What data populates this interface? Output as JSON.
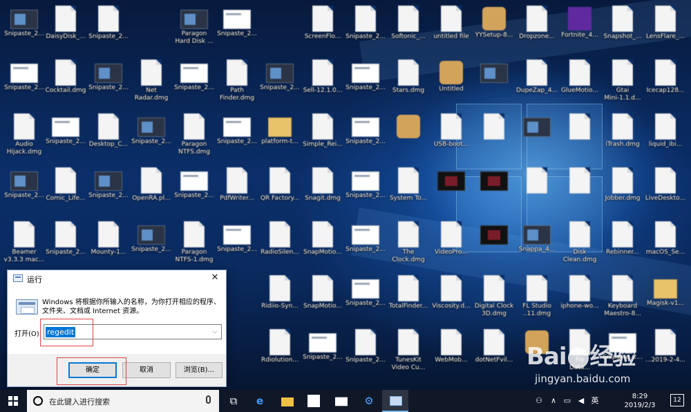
{
  "desktop": {
    "icons": [
      {
        "label": "Snipaste_2...",
        "kind": "dark"
      },
      {
        "label": "DaisyDisk_...",
        "kind": "file"
      },
      {
        "label": "Snipaste_2...",
        "kind": "file"
      },
      {
        "label": "Paragon\nHard Disk ...",
        "kind": "dark"
      },
      {
        "label": "Snipaste_2...",
        "kind": "shot"
      },
      {
        "label": "ScreenFlo...",
        "kind": "file"
      },
      {
        "label": "Snipaste_2...",
        "kind": "file"
      },
      {
        "label": "Softonic_...",
        "kind": "file"
      },
      {
        "label": "untitled file",
        "kind": "file"
      },
      {
        "label": "YYSetup-8...",
        "kind": "app"
      },
      {
        "label": "Dropzone...",
        "kind": "file"
      },
      {
        "label": "Fortnite_4...",
        "kind": "purple"
      },
      {
        "label": "Snapshot_...",
        "kind": "file"
      },
      {
        "label": "LensFlare_...",
        "kind": "file"
      },
      {
        "label": "Snipaste_2...",
        "kind": "shot"
      },
      {
        "label": "Cocktail.dmg",
        "kind": "file"
      },
      {
        "label": "Snipaste_2...",
        "kind": "dark"
      },
      {
        "label": "Net\nRadar.dmg",
        "kind": "file"
      },
      {
        "label": "Snipaste_2...",
        "kind": "shot"
      },
      {
        "label": "Path\nFinder.dmg",
        "kind": "file"
      },
      {
        "label": "Snipaste_2...",
        "kind": "dark"
      },
      {
        "label": "Sell-12.1.0...",
        "kind": "file"
      },
      {
        "label": "Snipaste_2...",
        "kind": "shot"
      },
      {
        "label": "Stars.dmg",
        "kind": "file"
      },
      {
        "label": "Untitled",
        "kind": "app"
      },
      {
        "label": "",
        "kind": "dark"
      },
      {
        "label": "DupeZap_4...",
        "kind": "file"
      },
      {
        "label": "GlueMotio...",
        "kind": "file"
      },
      {
        "label": "Gtai\nMini-1.1.d...",
        "kind": "file"
      },
      {
        "label": "Icecap128...",
        "kind": "file"
      },
      {
        "label": "Audio\nHijack.dmg",
        "kind": "file"
      },
      {
        "label": "Snipaste_2...",
        "kind": "shot"
      },
      {
        "label": "Desktop_C...",
        "kind": "file"
      },
      {
        "label": "Snipaste_2...",
        "kind": "dark"
      },
      {
        "label": "Paragon\nNTFS.dmg",
        "kind": "file"
      },
      {
        "label": "Snipaste_2...",
        "kind": "shot"
      },
      {
        "label": "platform-t...",
        "kind": "folder"
      },
      {
        "label": "Simple_Rei...",
        "kind": "file"
      },
      {
        "label": "Snipaste_2...",
        "kind": "shot"
      },
      {
        "label": "",
        "kind": "app"
      },
      {
        "label": "USB-boot...",
        "kind": "file"
      },
      {
        "label": "",
        "kind": "file"
      },
      {
        "label": "",
        "kind": "dark"
      },
      {
        "label": "",
        "kind": "file"
      },
      {
        "label": "iTrash.dmg",
        "kind": "file"
      },
      {
        "label": "liquid_ibi...",
        "kind": "file"
      },
      {
        "label": "Snipaste_2...",
        "kind": "dark"
      },
      {
        "label": "Comic_Life...",
        "kind": "file"
      },
      {
        "label": "Snipaste_2...",
        "kind": "dark"
      },
      {
        "label": "OpenRA.pl...",
        "kind": "file"
      },
      {
        "label": "Snipaste_2...",
        "kind": "shot"
      },
      {
        "label": "PdfWriter...",
        "kind": "file"
      },
      {
        "label": "QR Factory...",
        "kind": "file"
      },
      {
        "label": "Snagit.dmg",
        "kind": "file"
      },
      {
        "label": "Snipaste_2...",
        "kind": "shot"
      },
      {
        "label": "System To...",
        "kind": "file"
      },
      {
        "label": "",
        "kind": "black"
      },
      {
        "label": "",
        "kind": "black"
      },
      {
        "label": "",
        "kind": "file"
      },
      {
        "label": "",
        "kind": "file"
      },
      {
        "label": "Jobber.dmg",
        "kind": "file"
      },
      {
        "label": "LiveDeskto...",
        "kind": "file"
      },
      {
        "label": "Beamer\nv3.3.3 mac...",
        "kind": "file"
      },
      {
        "label": "Snipaste_2...",
        "kind": "file"
      },
      {
        "label": "Mounty-1...",
        "kind": "file"
      },
      {
        "label": "Snipaste_2...",
        "kind": "dark"
      },
      {
        "label": "Paragon\nNTFS-1.dmg",
        "kind": "file"
      },
      {
        "label": "Snipaste_2...",
        "kind": "shot"
      },
      {
        "label": "RadioSilen...",
        "kind": "file"
      },
      {
        "label": "SnapMotio...",
        "kind": "file"
      },
      {
        "label": "Snipaste_2...",
        "kind": "shot"
      },
      {
        "label": "The\nClock.dmg",
        "kind": "file"
      },
      {
        "label": "VideoPro...",
        "kind": "file"
      },
      {
        "label": "",
        "kind": "black"
      },
      {
        "label": "Snappa_4...",
        "kind": "dark"
      },
      {
        "label": "Disk\nClean.dmg",
        "kind": "file"
      },
      {
        "label": "Rebinner...",
        "kind": "file"
      },
      {
        "label": "macOS_Se...",
        "kind": "file"
      },
      {
        "label": "Ridiio-Syn...",
        "kind": "file"
      },
      {
        "label": "SnapMotio...",
        "kind": "file"
      },
      {
        "label": "Snipaste_2...",
        "kind": "shot"
      },
      {
        "label": "TotalFinder...",
        "kind": "file"
      },
      {
        "label": "Viscosity.d...",
        "kind": "file"
      },
      {
        "label": "Digital Clock\n3D.dmg",
        "kind": "file"
      },
      {
        "label": "FL Studio\n..11.dmg",
        "kind": "file"
      },
      {
        "label": "iphone-wo...",
        "kind": "file"
      },
      {
        "label": "Keyboard\nMaestro-8...",
        "kind": "file"
      },
      {
        "label": "Magisk-v1...",
        "kind": "folder"
      },
      {
        "label": "Rdiolution...",
        "kind": "file"
      },
      {
        "label": "Snipaste_2...",
        "kind": "shot"
      },
      {
        "label": "Snipaste_2...",
        "kind": "file"
      },
      {
        "label": "TunesKit\nVideo Cu...",
        "kind": "file"
      },
      {
        "label": "WebMob...",
        "kind": "file"
      },
      {
        "label": "dotNetFvil...",
        "kind": "file"
      },
      {
        "label": "",
        "kind": "app"
      },
      {
        "label": "Fix\nData...",
        "kind": "file"
      },
      {
        "label": "Snipaste_2...",
        "kind": "shot"
      },
      {
        "label": "...2019-2-4...",
        "kind": "file"
      }
    ]
  },
  "run_dialog": {
    "title": "运行",
    "close_glyph": "✕",
    "description": "Windows 将根据你所输入的名称，为你打开相应的程序、文件夹、文档或 Internet 资源。",
    "open_label": "打开(O):",
    "open_value": "regedit",
    "dropdown_glyph": "⌵",
    "ok_label": "确定",
    "cancel_label": "取消",
    "browse_label": "浏览(B)...",
    "highlight_color": "#dd4444"
  },
  "watermark": {
    "brand_left": "Bai",
    "brand_right": "经验",
    "url": "jingyan.baidu.com"
  },
  "taskbar": {
    "search_placeholder": "在此键入进行搜索",
    "apps": [
      {
        "name": "task-view",
        "glyph": "⧉"
      },
      {
        "name": "edge",
        "glyph": "e"
      },
      {
        "name": "file-explorer",
        "glyph": ""
      },
      {
        "name": "store",
        "glyph": ""
      },
      {
        "name": "mail",
        "glyph": ""
      },
      {
        "name": "settings",
        "glyph": "⚙"
      },
      {
        "name": "run",
        "glyph": ""
      }
    ],
    "tray": {
      "people_glyph": "⚇",
      "chevron_glyph": "∧",
      "network_glyph": "▭",
      "volume_glyph": "◀",
      "ime_label": "英",
      "time": "8:29",
      "date": "2019/2/3",
      "notification_count": "12"
    }
  }
}
